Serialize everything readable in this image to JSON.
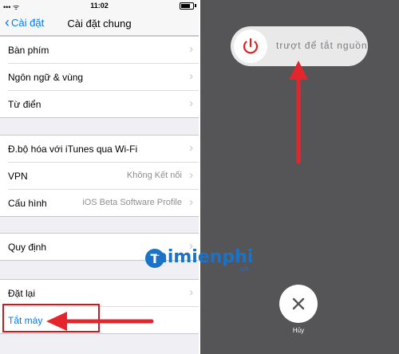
{
  "status_bar": {
    "signal": "••• ᯤ",
    "time": "11:02"
  },
  "navbar": {
    "back_label": "Cài đặt",
    "title": "Cài đặt chung"
  },
  "settings": {
    "group1": [
      {
        "label": "Bàn phím"
      },
      {
        "label": "Ngôn ngữ & vùng"
      },
      {
        "label": "Từ điển"
      }
    ],
    "group2": [
      {
        "label": "Đ.bộ hóa với iTunes qua Wi-Fi",
        "value": ""
      },
      {
        "label": "VPN",
        "value": "Không Kết nối"
      },
      {
        "label": "Cấu hình",
        "value": "iOS Beta Software Profile"
      }
    ],
    "group3": [
      {
        "label": "Quy định"
      }
    ],
    "group4": [
      {
        "label": "Đặt lại"
      },
      {
        "label": "Tắt máy"
      }
    ]
  },
  "power_off": {
    "slider_text": "trượt để tắt nguồn",
    "cancel_label": "Hủy"
  },
  "watermark": {
    "text": "aimienphi",
    "suffix": ".vn"
  },
  "colors": {
    "highlight": "#d8141a",
    "ios_blue": "#007aff",
    "power_red": "#e02020"
  }
}
